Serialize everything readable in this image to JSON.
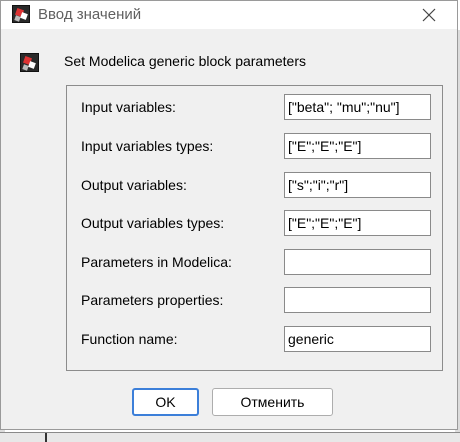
{
  "window": {
    "title": "Ввод значений"
  },
  "header": {
    "text": "Set Modelica generic block parameters"
  },
  "fields": [
    {
      "label": "Input variables:",
      "value": "[\"beta\"; \"mu\";\"nu\"]"
    },
    {
      "label": "Input variables types:",
      "value": "[\"E\";\"E\";\"E\"]"
    },
    {
      "label": "Output variables:",
      "value": "[\"s\";\"i\";\"r\"]"
    },
    {
      "label": "Output variables types:",
      "value": "[\"E\";\"E\";\"E\"]"
    },
    {
      "label": "Parameters in Modelica:",
      "value": ""
    },
    {
      "label": "Parameters properties:",
      "value": ""
    },
    {
      "label": "Function name:",
      "value": "generic"
    }
  ],
  "buttons": {
    "ok": "OK",
    "cancel": "Отменить"
  },
  "icons": {
    "app": "scilab-block-icon",
    "close": "close-icon"
  },
  "colors": {
    "ok_border": "#3c7fd9",
    "dialog_bg": "#f0f0f0"
  }
}
